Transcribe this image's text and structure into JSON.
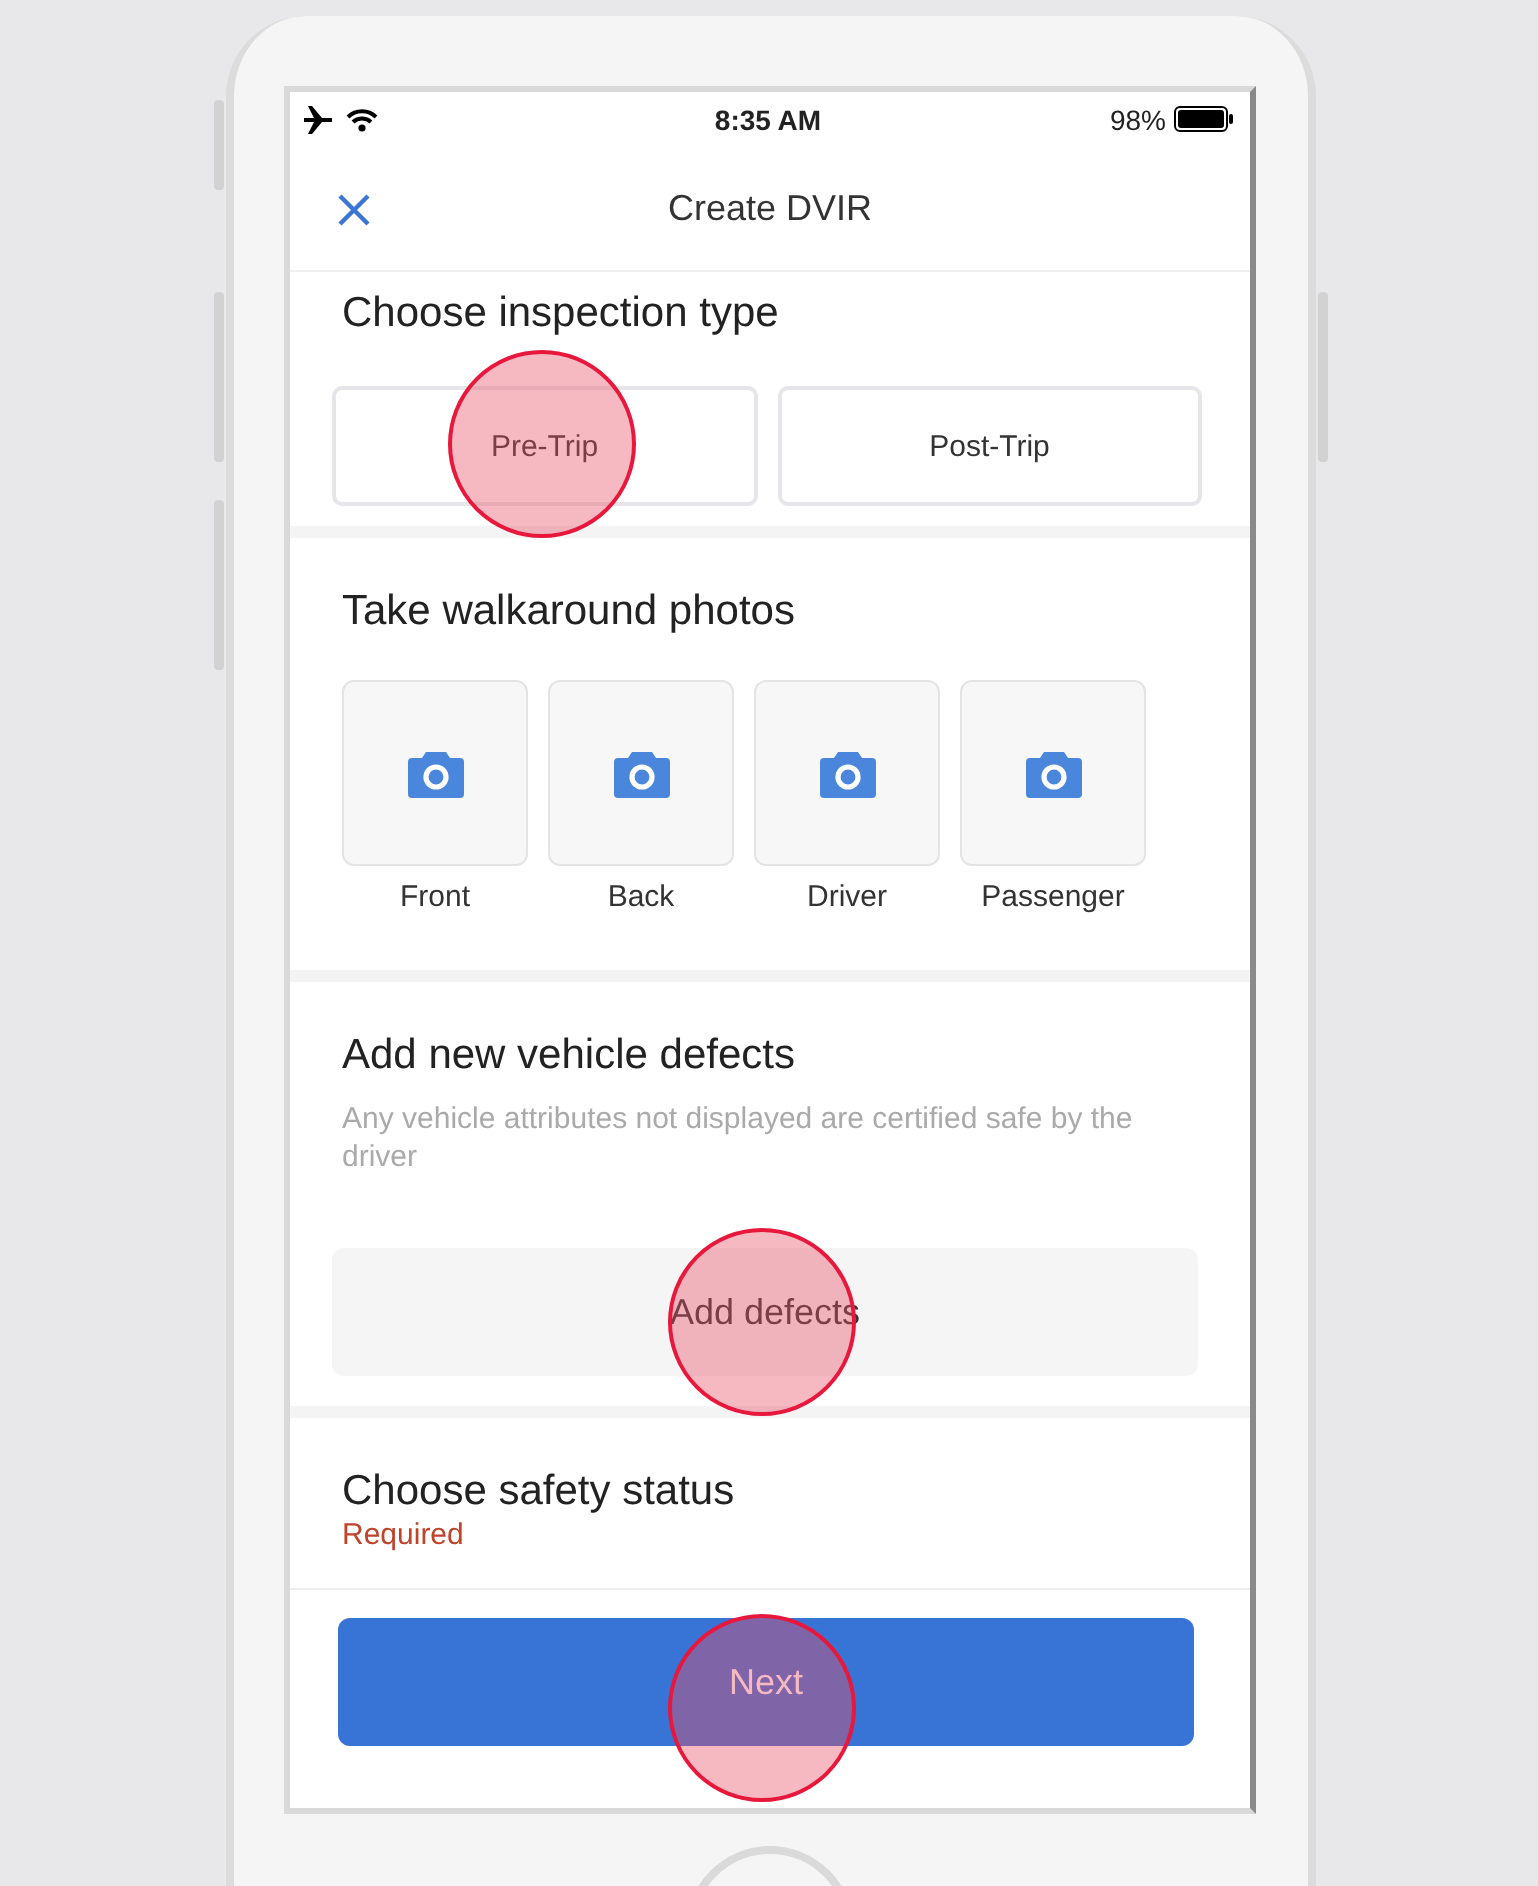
{
  "status_bar": {
    "time": "8:35 AM",
    "battery": "98%"
  },
  "nav_bar": {
    "title": "Create DVIR"
  },
  "inspection_type": {
    "heading": "Choose inspection type",
    "options": [
      {
        "label": "Pre-Trip"
      },
      {
        "label": "Post-Trip"
      }
    ]
  },
  "walkaround_photos": {
    "heading": "Take walkaround photos",
    "slots": [
      {
        "label": "Front"
      },
      {
        "label": "Back"
      },
      {
        "label": "Driver"
      },
      {
        "label": "Passenger"
      }
    ]
  },
  "vehicle_defects": {
    "heading": "Add new vehicle defects",
    "description": "Any vehicle attributes not displayed are certified safe by the driver",
    "button": "Add defects"
  },
  "safety_status": {
    "heading": "Choose safety status",
    "note": "Required"
  },
  "next_button": "Next"
}
